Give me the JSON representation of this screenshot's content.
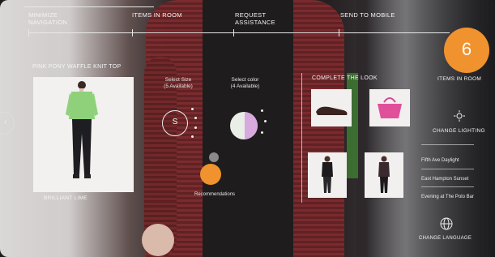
{
  "nav": {
    "minimize": "MINIMIZE\nNAVIGATION",
    "items_in_room": "ITEMS IN ROOM",
    "request_assistance": "REQUEST\nASSISTANCE",
    "send_to_mobile": "SEND TO MOBILE"
  },
  "product": {
    "title": "PINK PONY WAFFLE KNIT TOP",
    "color_name": "BRILLIANT LIME",
    "select_size_label": "Select Size",
    "sizes_available": "(5 Available)",
    "size_selected": "S",
    "select_color_label": "Select color",
    "colors_available": "(4 Available)",
    "recommendations": "Recommendations"
  },
  "complete_look": {
    "title": "COMPLETE THE LOOK"
  },
  "room": {
    "count": "6",
    "label": "ITEMS IN ROOM"
  },
  "lighting": {
    "change_label": "CHANGE LIGHTING",
    "options": [
      "Fifth Ave Daylight",
      "East Hampton Sunset",
      "Evening at The Polo Bar"
    ]
  },
  "language": {
    "change_label": "CHANGE LANGUAGE"
  },
  "colors": {
    "accent_orange": "#f0922e",
    "ui_white": "#f2f2f2",
    "swatch_lime": "#c8e8a8",
    "swatch_pink": "#d7a9de"
  }
}
